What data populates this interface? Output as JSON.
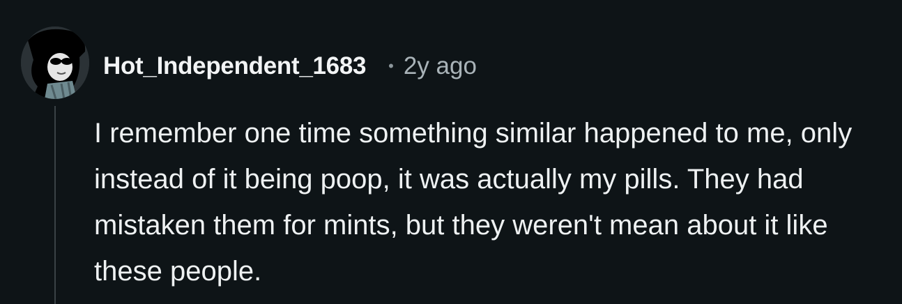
{
  "comment": {
    "username": "Hot_Independent_1683",
    "separator": "•",
    "timestamp": "2y ago",
    "body": "I remember one time something similar happened to me, only instead of it being poop, it was actually my pills. They had mistaken them for mints, but they weren't mean about it like these people."
  },
  "colors": {
    "background": "#0e1417",
    "text": "#eef1f2",
    "muted": "#a9b3b8",
    "thread_line": "#3a4246"
  },
  "icons": {
    "avatar": "user-avatar-icon"
  }
}
